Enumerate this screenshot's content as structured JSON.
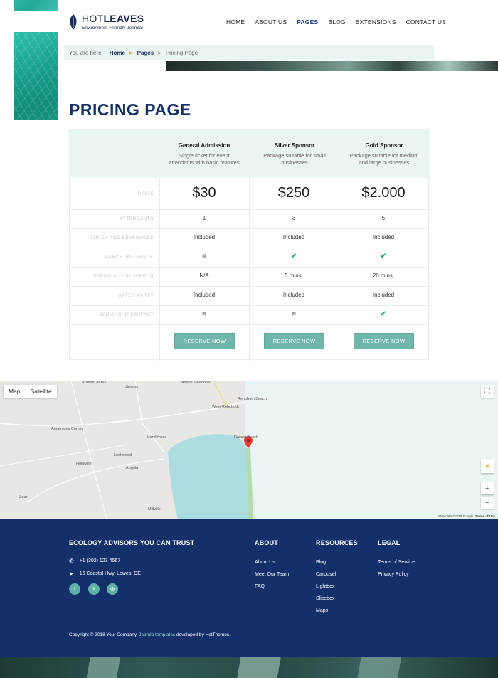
{
  "brand": {
    "name_light": "HOT",
    "name_bold": "LEAVES",
    "tagline": "Environment Friendly Joomla!"
  },
  "nav": {
    "items": [
      "HOME",
      "ABOUT US",
      "PAGES",
      "BLOG",
      "EXTENSIONS",
      "CONTACT US"
    ],
    "active": "PAGES"
  },
  "breadcrumb": {
    "prefix": "You are here:",
    "items": [
      "Home",
      "Pages",
      "Pricing Page"
    ]
  },
  "page_title": "PRICING PAGE",
  "pricing": {
    "plans": [
      {
        "name": "General Admission",
        "desc_line1": "Single ticket for event",
        "desc_line2": "attendants with basic features",
        "price": "$30"
      },
      {
        "name": "Silver Sponsor",
        "desc_line1": "Package suitable for small",
        "desc_line2": "businesses",
        "price": "$250"
      },
      {
        "name": "Gold Sponsor",
        "desc_line1": "Package suitable for medium",
        "desc_line2": "and large businesses",
        "price": "$2.000"
      }
    ],
    "row_labels": [
      "PRICE",
      "ATTENDANTS",
      "LUNCH AND BEVERAGES",
      "MARKETING SPACE",
      "INTRODUCTION SPEECH",
      "AFTER PARTY",
      "BED AND BREAKFAST"
    ],
    "attendants": [
      "1",
      "3",
      "5"
    ],
    "lunch": [
      "Included",
      "Included",
      "Included"
    ],
    "marketing": [
      "cross-icon",
      "check-icon",
      "check-icon"
    ],
    "speech": [
      "N/A",
      "5 mins.",
      "20 mins."
    ],
    "after_party": [
      "Included",
      "Included",
      "Included"
    ],
    "bed_breakfast": [
      "cross-icon",
      "cross-icon",
      "check-icon"
    ],
    "reserve_label": "RESERVE NOW",
    "check_glyph": "✔",
    "cross_glyph": "✖"
  },
  "map": {
    "type_map": "Map",
    "type_satellite": "Satellite",
    "places": [
      "Arabian Acres",
      "Jimtown",
      "Aspen Meadows",
      "Rehoboth Beach",
      "West Rehoboth",
      "Andersons Corner",
      "Marshtown",
      "Lochwood",
      "Dewey Beach",
      "Hollyville",
      "Angola",
      "Zoar",
      "Millville"
    ],
    "attribution": "Map data ©2018 Google",
    "terms": "Terms of Use",
    "zoom_in": "+",
    "zoom_out": "−"
  },
  "footer": {
    "title": "ECOLOGY ADVISORS YOU CAN TRUST",
    "phone": "+1 (302) 123 4567",
    "address": "16 Coastal Hwy, Lewes, DE",
    "about_title": "ABOUT",
    "about_links": [
      "About Us",
      "Meet Our Team",
      "FAQ"
    ],
    "resources_title": "RESOURCES",
    "resources_links": [
      "Blog",
      "Carousel",
      "Lightbox",
      "Slicebox",
      "Maps"
    ],
    "legal_title": "LEGAL",
    "legal_links": [
      "Terms of Service",
      "Privacy Policy"
    ],
    "copyright_pre": "Copyright © 2018 Your Company.",
    "copyright_link": "Joomla templates",
    "copyright_post": "developed by HotThemes."
  },
  "colors": {
    "accent": "#6fb6ac",
    "navy": "#14306b",
    "check": "#19b56b"
  }
}
